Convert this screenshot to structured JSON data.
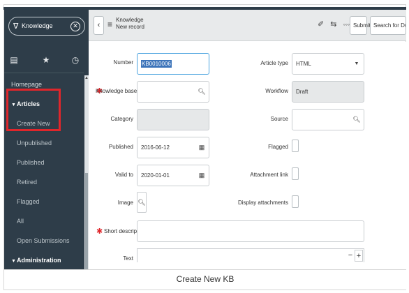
{
  "sidebar": {
    "filter_value": "Knowledge",
    "filter_icon": "funnel-icon",
    "clear_icon": "clear-circle-icon",
    "tab_icons": [
      "document-icon",
      "star-icon",
      "clock-icon"
    ],
    "items": [
      {
        "label": "Homepage",
        "kind": "item"
      },
      {
        "label": "Articles",
        "kind": "section"
      },
      {
        "label": "Create New",
        "kind": "sub"
      },
      {
        "label": "Unpublished",
        "kind": "sub"
      },
      {
        "label": "Published",
        "kind": "sub"
      },
      {
        "label": "Retired",
        "kind": "sub"
      },
      {
        "label": "Flagged",
        "kind": "sub"
      },
      {
        "label": "All",
        "kind": "sub"
      },
      {
        "label": "Open Submissions",
        "kind": "sub"
      },
      {
        "label": "Administration",
        "kind": "section"
      }
    ],
    "highlight_color": "#e0262b"
  },
  "header": {
    "back_icon": "chevron-left-icon",
    "menu_icon": "hamburger-icon",
    "title_line1": "Knowledge",
    "title_line2": "New record",
    "icons": [
      "paperclip-icon",
      "settings-sliders-icon",
      "more-icon"
    ],
    "submit_label": "Submit",
    "search_label": "Search for Duplicates"
  },
  "form": {
    "number_label": "Number",
    "number_value": "KB0010006",
    "knowledge_base_label": "Knowledge base",
    "category_label": "Category",
    "published_label": "Published",
    "published_value": "2016-06-12",
    "valid_to_label": "Valid to",
    "valid_to_value": "2020-01-01",
    "image_label": "Image",
    "short_description_label": "Short description",
    "text_label": "Text",
    "article_type_label": "Article type",
    "article_type_value": "HTML",
    "workflow_label": "Workflow",
    "workflow_value": "Draft",
    "source_label": "Source",
    "flagged_label": "Flagged",
    "attachment_link_label": "Attachment link",
    "display_attachments_label": "Display attachments",
    "minus": "−",
    "plus": "+"
  },
  "caption": "Create New KB",
  "colors": {
    "sidebar_bg": "#2e3d49",
    "header_bg": "#e8eaeb",
    "required": "#e0262b",
    "focus": "#4aa3df",
    "selection": "#3b73b9"
  }
}
